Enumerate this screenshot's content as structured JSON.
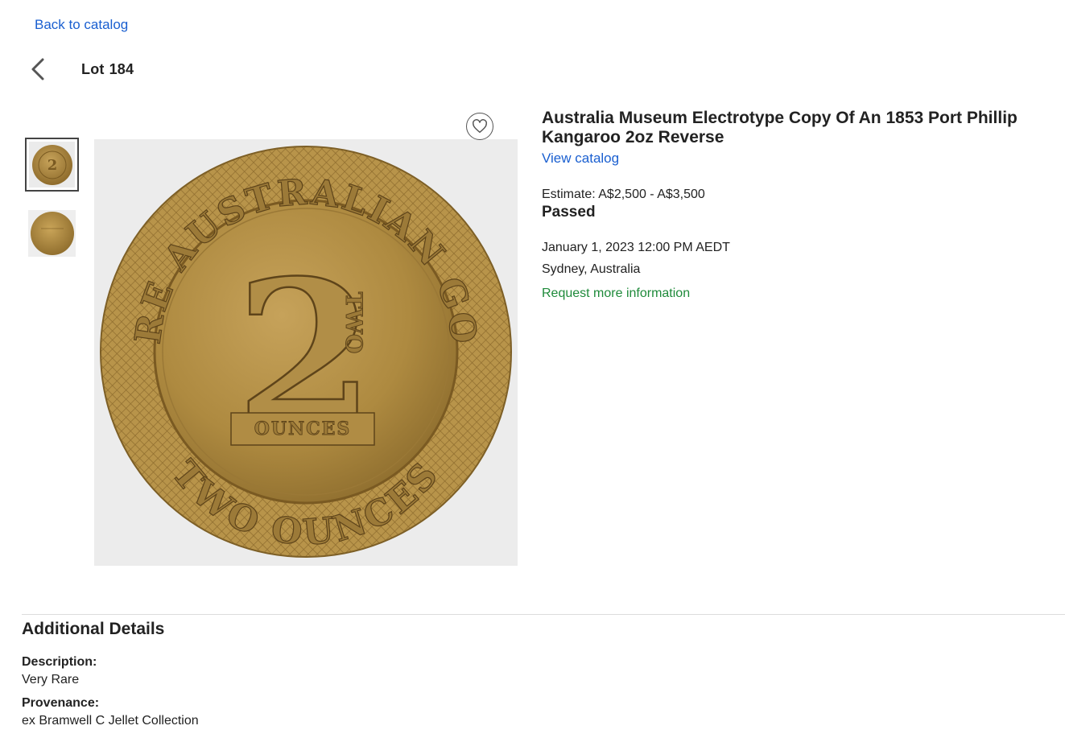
{
  "nav": {
    "back_to_catalog": "Back to catalog",
    "lot_prefix": "Lot",
    "lot_number": "184"
  },
  "icons": {
    "back": "chevron-left-icon",
    "favorite": "heart-icon"
  },
  "lot": {
    "title": "Australia Museum Electrotype Copy Of An 1853 Port Phillip Kangaroo 2oz Reverse",
    "view_catalog": "View catalog",
    "estimate": "Estimate: A$2,500 - A$3,500",
    "status": "Passed",
    "date": "January 1, 2023 12:00 PM AEDT",
    "location": "Sydney, Australia",
    "request_info": "Request more information"
  },
  "coin": {
    "top_legend": "PURE AUSTRALIAN GOLD",
    "bottom_legend": "TWO OUNCES",
    "numeral": "2",
    "word": "TWO",
    "banner": "OUNCES"
  },
  "details": {
    "heading": "Additional Details",
    "fields": [
      {
        "label": "Description:",
        "value": "Very Rare"
      },
      {
        "label": "Provenance:",
        "value": "ex Bramwell C Jellet Collection"
      }
    ]
  },
  "colors": {
    "link": "#1a5fd0",
    "request_link": "#1e8a3a",
    "coin_gold": "#b08a3e"
  }
}
